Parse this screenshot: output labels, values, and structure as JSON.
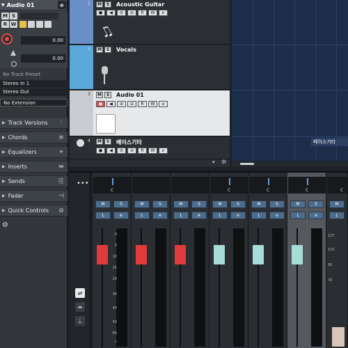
{
  "inspector": {
    "track_name": "Audio 01",
    "ms_m": "M",
    "ms_s": "S",
    "ms_r": "R",
    "ms_w": "W",
    "volume_value": "0.00",
    "pan_value": "0.00",
    "preset": "No Track Preset",
    "input": "Stereo In 1",
    "output": "Stereo Out",
    "extension": "No Extension",
    "sections": [
      "Track Versions",
      "Chords",
      "Equalizers",
      "Inserts",
      "Sends",
      "Fader",
      "Quick Controls"
    ]
  },
  "tracks": [
    {
      "num": "1",
      "name": "Acoustic Guitar"
    },
    {
      "num": "2",
      "name": "Vocals"
    },
    {
      "num": "3",
      "name": "Audio 01"
    },
    {
      "num": "4",
      "name": "베이스기타"
    }
  ],
  "arrange": {
    "event_label": "베이스기타"
  },
  "mixer": {
    "strip_labels": [
      "C",
      "C",
      "C",
      "C",
      "C",
      "C",
      "C"
    ],
    "m": "M",
    "s": "S",
    "l": "L",
    "e": "e",
    "scale": [
      "0",
      "5",
      "10",
      "15",
      "20",
      "30",
      "40",
      "50",
      "60",
      "∞"
    ],
    "right_scale": [
      "127",
      "110",
      "90",
      "70"
    ],
    "fader_colors": [
      "#e03b3b",
      "#e03b3b",
      "#e03b3b",
      "#a9dcd6",
      "#a9dcd6",
      "#a9dcd6"
    ]
  },
  "colors": {
    "track_guitar": "#6a8fc7",
    "track_vocals": "#5aa7da",
    "track_audio": "#c9ccd1",
    "accent": "#e84b4b"
  }
}
